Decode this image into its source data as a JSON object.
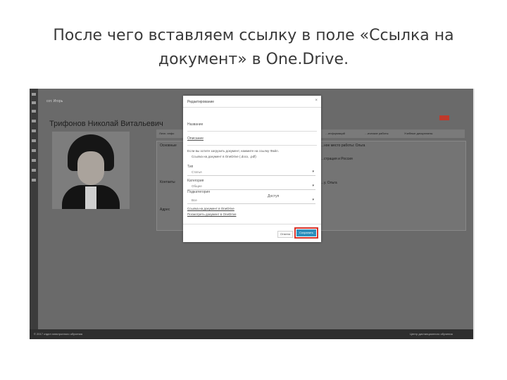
{
  "slide": {
    "title_line1": "После чего вставляем ссылку в поле «Ссылка на",
    "title_line2": "документ» в One.Drive."
  },
  "app": {
    "breadcrumb": "сот. Игорь",
    "person_name": "Трифонов Николай Витальевич",
    "tabs": [
      "Личн. инфо",
      "…информаций",
      "…ические работы",
      "Учебные дисциплины"
    ],
    "panel_labels": {
      "left_header": "Основные",
      "left_row2": "Контакты",
      "left_row3": "Адрес",
      "right_header": "…ное место работы: Ольга",
      "right_row1": "…страция и Россия",
      "right_row2": "…у. Ольга"
    },
    "footer_left": "© 2017 отдел электронного обучения",
    "footer_right": "Центр дистанционного обучения"
  },
  "modal": {
    "title": "Редактирование",
    "close": "×",
    "field_name_label": "Название",
    "field_desc_label": "Описание",
    "note_line1": "Если вы хотите загрузить документ, нажмите на ссылку Файл.",
    "note_line2": "Ссылка на документ в OneDrive (.docx, .pdf)",
    "type_label": "Тип",
    "type_value": "Статья",
    "category_label": "Категория",
    "category_value": "Общее",
    "access_label": "Доступ",
    "access_value": "Все",
    "extra_label": "Подкатегория",
    "link_line1": "Ссылка на документ в OneDrive",
    "link_line2": "Посмотреть документ в OneDrive",
    "cancel": "Отмена",
    "save": "Сохранить"
  },
  "colors": {
    "accent_save": "#2d8fbd",
    "highlight_border": "#d9342b"
  }
}
